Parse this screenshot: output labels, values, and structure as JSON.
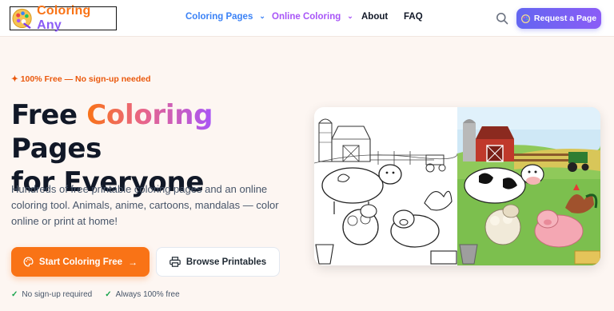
{
  "header": {
    "logo": {
      "text_part1": "Coloring",
      "text_part2": "Any",
      "icon": "palette-icon"
    },
    "nav": [
      {
        "label": "Coloring Pages",
        "has_dropdown": true,
        "color": "#3b82f6"
      },
      {
        "label": "Online Coloring",
        "has_dropdown": true,
        "color": "#a855f7"
      },
      {
        "label": "About",
        "has_dropdown": false
      },
      {
        "label": "FAQ",
        "has_dropdown": false
      }
    ],
    "search_icon": "search-icon",
    "request_button": {
      "label": "Request a Page",
      "icon": "palette-icon"
    }
  },
  "hero": {
    "badge": "✦ 100% Free — No sign-up needed",
    "title_part1": "Free ",
    "title_highlight": "Coloring",
    "title_part2": " Pages",
    "title_line2": "for Everyone",
    "description": "Hundreds of free printable coloring pages and an online coloring tool. Animals, anime, cartoons, mandalas — color online or print at home!",
    "primary_button": {
      "label": "Start Coloring Free",
      "icon": "palette-icon",
      "trailing_icon": "arrow-right-icon"
    },
    "secondary_button": {
      "label": "Browse Printables",
      "icon": "printer-icon"
    },
    "checks": [
      "No sign-up required",
      "Always 100% free"
    ],
    "image": {
      "subject": "farm-animals-coloring-illustration"
    }
  },
  "colors": {
    "brand_orange": "#f97316",
    "brand_purple": "#8b5cf6",
    "nav_blue": "#3b82f6",
    "page_bg": "#fdf6f2"
  }
}
